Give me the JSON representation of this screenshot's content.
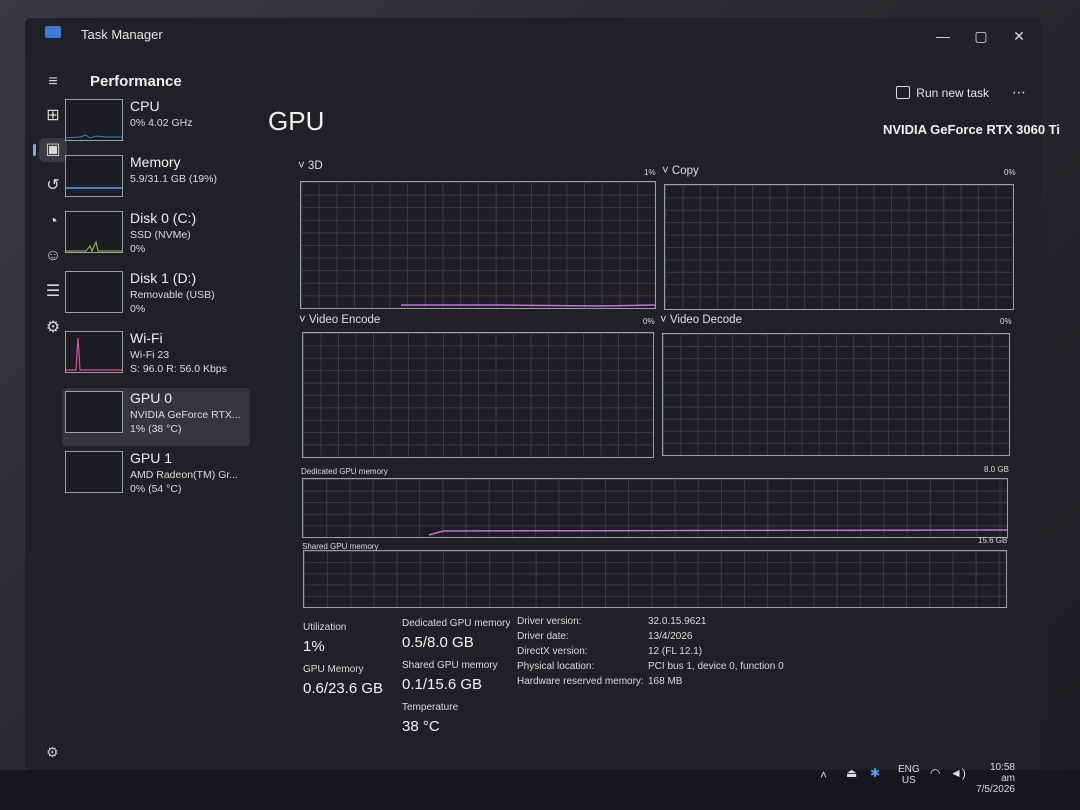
{
  "window": {
    "title": "Task Manager",
    "minimize": "—",
    "maximize": "▢",
    "close": "✕"
  },
  "nav": {
    "icons": [
      "hamburger-icon",
      "processes-icon",
      "performance-icon",
      "app-history-icon",
      "startup-icon",
      "users-icon",
      "details-icon",
      "services-icon"
    ]
  },
  "header": {
    "page_title": "Performance",
    "run_task": "Run new task",
    "more": "⋯"
  },
  "devices": [
    {
      "name": "CPU",
      "line1": "0% 4.02 GHz",
      "line2": ""
    },
    {
      "name": "Memory",
      "line1": "5.9/31.1 GB (19%)",
      "line2": ""
    },
    {
      "name": "Disk 0 (C:)",
      "line1": "SSD (NVMe)",
      "line2": "0%"
    },
    {
      "name": "Disk 1 (D:)",
      "line1": "Removable (USB)",
      "line2": "0%"
    },
    {
      "name": "Wi-Fi",
      "line1": "Wi-Fi 23",
      "line2": "S: 96.0 R: 56.0 Kbps"
    },
    {
      "name": "GPU 0",
      "line1": "NVIDIA GeForce RTX...",
      "line2": "1% (38 °C)"
    },
    {
      "name": "GPU 1",
      "line1": "AMD Radeon(TM) Gr...",
      "line2": "0% (54 °C)"
    }
  ],
  "gpu": {
    "title": "GPU",
    "model": "NVIDIA GeForce RTX 3060 Ti",
    "engines": [
      {
        "label": "3D",
        "value": "1%"
      },
      {
        "label": "Copy",
        "value": "0%"
      },
      {
        "label": "Video Encode",
        "value": "0%"
      },
      {
        "label": "Video Decode",
        "value": "0%"
      }
    ],
    "dedicated_label": "Dedicated GPU memory",
    "dedicated_max": "8.0 GB",
    "shared_label": "Shared GPU memory",
    "shared_max": "15.6 GB"
  },
  "stats": {
    "utilization_label": "Utilization",
    "utilization": "1%",
    "gpu_memory_label": "GPU Memory",
    "gpu_memory": "0.6/23.6 GB",
    "dedicated_label": "Dedicated GPU memory",
    "dedicated": "0.5/8.0 GB",
    "shared_label": "Shared GPU memory",
    "shared": "0.1/15.6 GB",
    "temp_label": "Temperature",
    "temp": "38 °C",
    "info": [
      {
        "k": "Driver version:",
        "v": "32.0.15.9621"
      },
      {
        "k": "Driver date:",
        "v": "13/4/2026"
      },
      {
        "k": "DirectX version:",
        "v": "12 (FL 12.1)"
      },
      {
        "k": "Physical location:",
        "v": "PCI bus 1, device 0, function 0"
      },
      {
        "k": "Hardware reserved memory:",
        "v": "168 MB"
      }
    ]
  },
  "taskbar": {
    "lang1": "ENG",
    "lang2": "US",
    "time": "10:58 am",
    "date": "7/5/2026"
  },
  "colors": {
    "gpu_line": "#c96ee0",
    "wifi_line": "#e04fa0",
    "mem_line": "#3d7fd6",
    "disk_line": "#9ccc45"
  }
}
